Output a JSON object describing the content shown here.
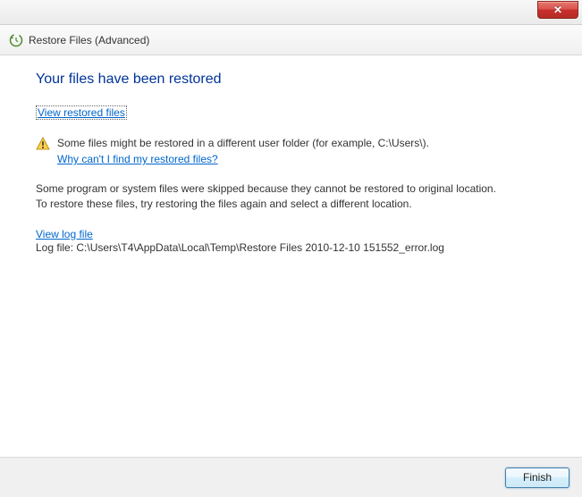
{
  "window": {
    "title": "Restore Files (Advanced)"
  },
  "heading": "Your files have been restored",
  "links": {
    "view_restored": "View restored files",
    "why_cant_find": "Why can't I find my restored files?",
    "view_log": "View log file"
  },
  "warning": {
    "text": "Some files might be restored in a different user folder (for example, C:\\Users\\)."
  },
  "skipped": {
    "line1": "Some program or system files were skipped because they cannot be restored to original location.",
    "line2": "To restore these files, try restoring the files again and select a different location."
  },
  "log": {
    "path": "Log file: C:\\Users\\T4\\AppData\\Local\\Temp\\Restore Files 2010-12-10 151552_error.log"
  },
  "buttons": {
    "finish": "Finish"
  }
}
